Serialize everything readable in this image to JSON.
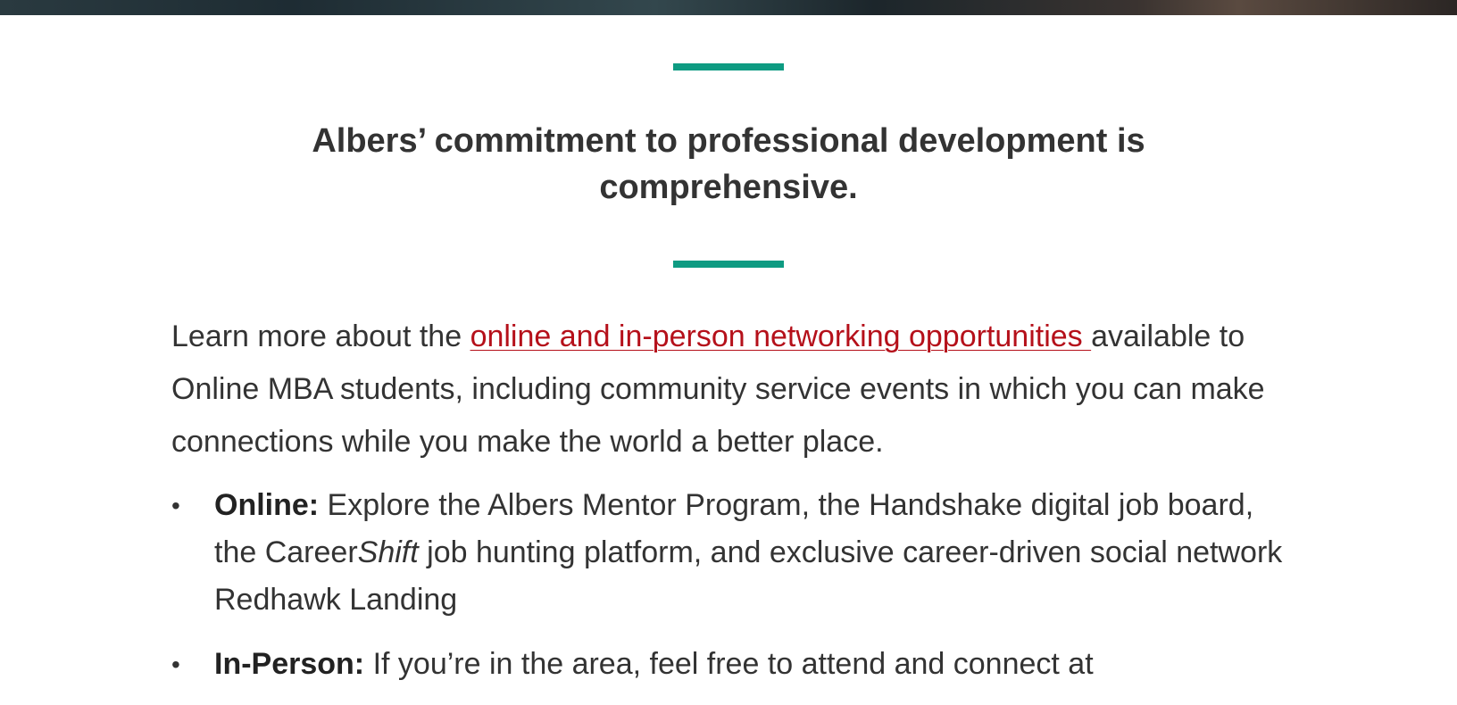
{
  "heading": "Albers’ commitment to professional development is comprehensive.",
  "intro": {
    "prefix": "Learn more about the ",
    "link_text": "online and in-person networking opportunities ",
    "suffix": "available to Online MBA students, including community service events in which you can make connections while you make the world a better place."
  },
  "bullets": [
    {
      "bullet": "•",
      "label": "Online:",
      "text_before": " Explore the Albers Mentor Program, the Handshake digital job board, the Career",
      "emphasis": "Shift",
      "text_after": " job hunting platform, and exclusive career-driven social network Redhawk Landing"
    },
    {
      "bullet": "•",
      "label": "In-Person:",
      "text": " If you’re in the area, feel free to attend and connect at"
    }
  ],
  "colors": {
    "accent_rule": "#0e9b82",
    "link": "#b5101a",
    "text": "#333333"
  }
}
